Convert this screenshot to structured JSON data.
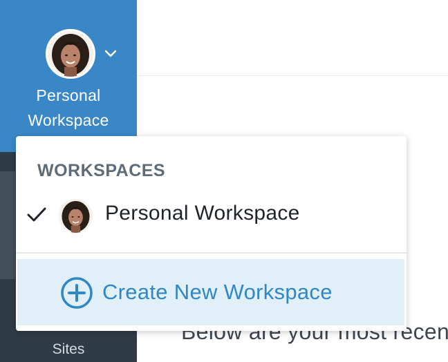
{
  "sidebar": {
    "workspace_name": "Personal Workspace",
    "avatar_icon": "user-avatar-icon",
    "chevron_icon": "chevron-down-icon",
    "bottom_item_label": "Sites",
    "accent_color": "#3a87c8"
  },
  "main": {
    "intro_text": "Below are your most recen"
  },
  "dropdown": {
    "heading": "WORKSPACES",
    "items": [
      {
        "label": "Personal Workspace",
        "selected": true,
        "icon": "check-icon"
      }
    ],
    "create_label": "Create New Workspace",
    "create_icon": "plus-circle-icon",
    "create_color": "#2f87c6"
  }
}
